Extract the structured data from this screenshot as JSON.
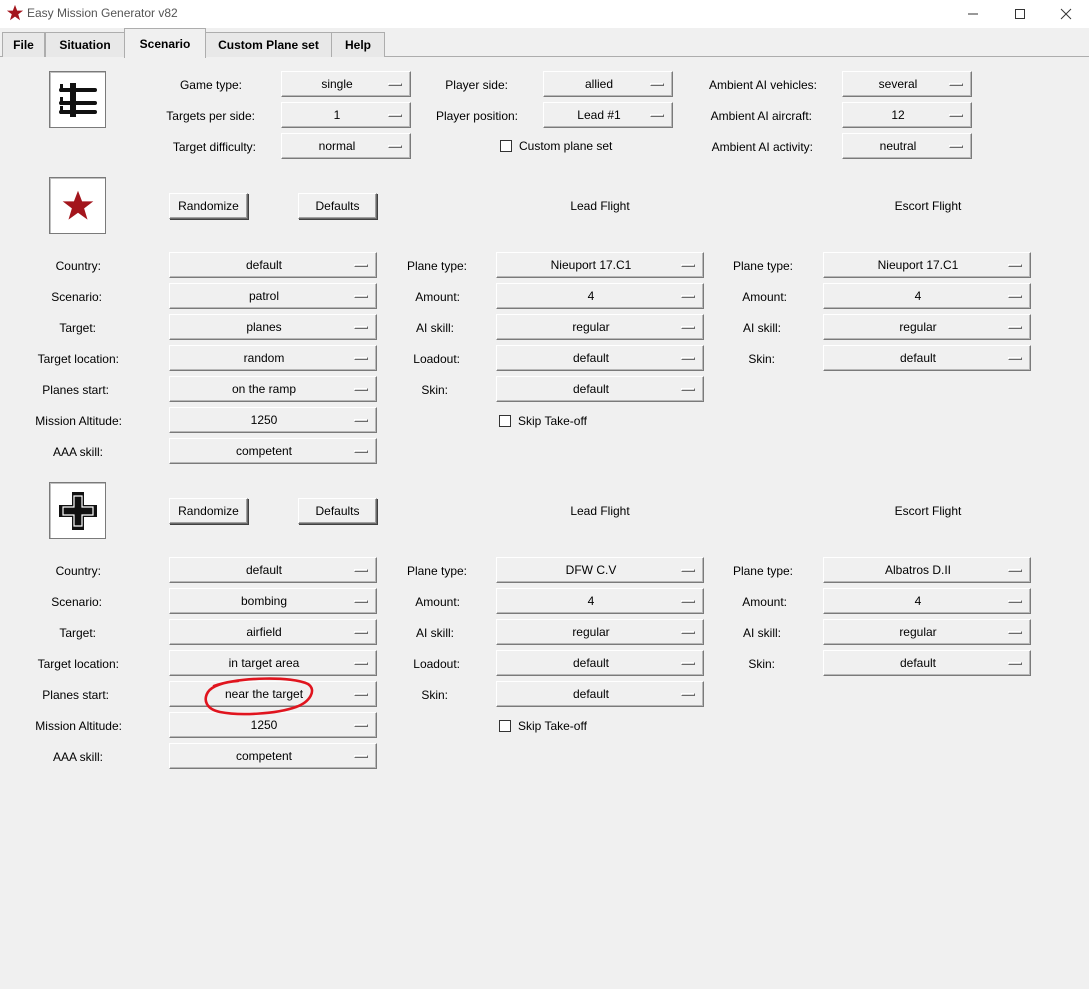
{
  "window": {
    "title": "Easy Mission Generator v82",
    "controls": {
      "minimize": "—",
      "maximize": "☐",
      "close": "✕"
    }
  },
  "tabs": [
    "File",
    "Situation",
    "Scenario",
    "Custom Plane set",
    "Help"
  ],
  "active_tab": "Scenario",
  "general": {
    "game_type_label": "Game type:",
    "game_type": "single",
    "targets_label": "Targets per side:",
    "targets": "1",
    "difficulty_label": "Target difficulty:",
    "difficulty": "normal",
    "player_side_label": "Player side:",
    "player_side": "allied",
    "player_position_label": "Player position:",
    "player_position": "Lead #1",
    "custom_plane_set_label": "Custom plane set",
    "ambient_vehicles_label": "Ambient AI vehicles:",
    "ambient_vehicles": "several",
    "ambient_aircraft_label": "Ambient AI aircraft:",
    "ambient_aircraft": "12",
    "ambient_activity_label": "Ambient AI activity:",
    "ambient_activity": "neutral"
  },
  "labels": {
    "randomize": "Randomize",
    "defaults": "Defaults",
    "lead_flight": "Lead Flight",
    "escort_flight": "Escort Flight",
    "country": "Country:",
    "scenario": "Scenario:",
    "target": "Target:",
    "target_location": "Target location:",
    "planes_start": "Planes start:",
    "mission_altitude": "Mission Altitude:",
    "aaa_skill": "AAA skill:",
    "plane_type": "Plane type:",
    "amount": "Amount:",
    "ai_skill": "AI skill:",
    "loadout": "Loadout:",
    "skin": "Skin:",
    "skip_takeoff": "Skip Take-off"
  },
  "allied": {
    "country": "default",
    "scenario": "patrol",
    "target": "planes",
    "target_location": "random",
    "planes_start": "on the ramp",
    "mission_altitude": "1250",
    "aaa_skill": "competent",
    "lead": {
      "plane_type": "Nieuport 17.C1",
      "amount": "4",
      "ai_skill": "regular",
      "loadout": "default",
      "skin": "default"
    },
    "escort": {
      "plane_type": "Nieuport 17.C1",
      "amount": "4",
      "ai_skill": "regular",
      "skin": "default"
    }
  },
  "axis": {
    "country": "default",
    "scenario": "bombing",
    "target": "airfield",
    "target_location": "in target area",
    "planes_start": "near the target",
    "mission_altitude": "1250",
    "aaa_skill": "competent",
    "lead": {
      "plane_type": "DFW C.V",
      "amount": "4",
      "ai_skill": "regular",
      "loadout": "default",
      "skin": "default"
    },
    "escort": {
      "plane_type": "Albatros D.II",
      "amount": "4",
      "ai_skill": "regular",
      "skin": "default"
    }
  },
  "colors": {
    "background": "#f0f0f0",
    "allied_star": "#a3151c",
    "annotation": "#e0141e"
  }
}
